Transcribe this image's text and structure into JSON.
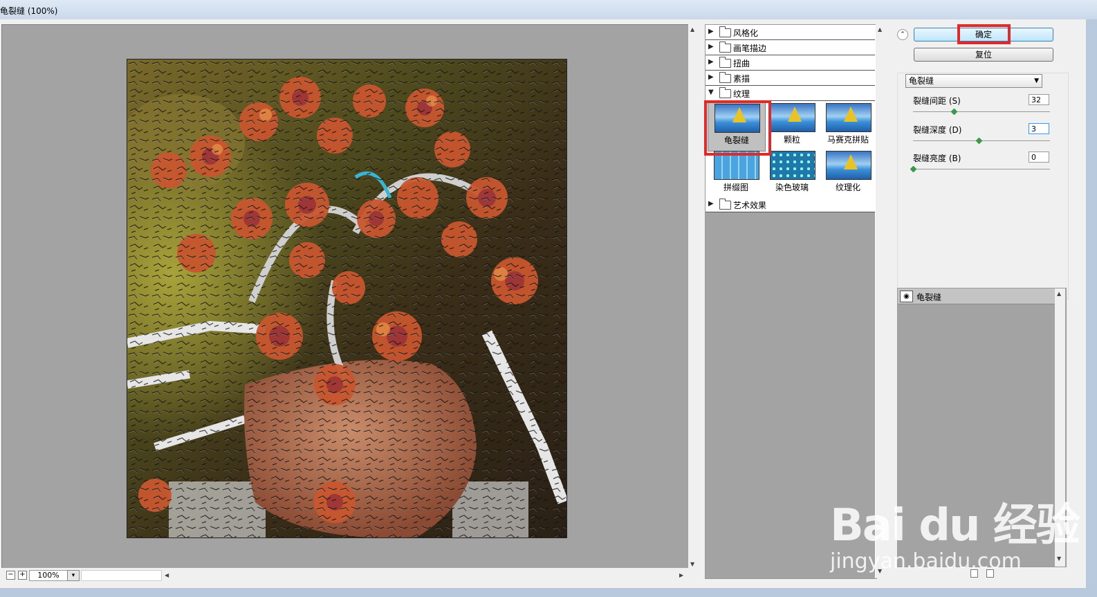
{
  "window": {
    "title": "龟裂缝 (100%)"
  },
  "preview": {
    "zoom_value": "100%",
    "zoom_out_symbol": "−",
    "zoom_in_symbol": "+",
    "dropdown_symbol": "▾",
    "image_alt": "Flowers in a vase with craquelure filter applied"
  },
  "gallery": {
    "categories_top": [
      {
        "label": "风格化",
        "expanded": false
      },
      {
        "label": "画笔描边",
        "expanded": false
      },
      {
        "label": "扭曲",
        "expanded": false
      },
      {
        "label": "素描",
        "expanded": false
      },
      {
        "label": "纹理",
        "expanded": true
      }
    ],
    "texture_filters": [
      {
        "label": "龟裂缝",
        "selected": true
      },
      {
        "label": "颗粒",
        "selected": false
      },
      {
        "label": "马赛克拼贴",
        "selected": false
      },
      {
        "label": "拼缀图",
        "selected": false
      },
      {
        "label": "染色玻璃",
        "selected": false
      },
      {
        "label": "纹理化",
        "selected": false
      }
    ],
    "category_bottom": {
      "label": "艺术效果",
      "expanded": false
    }
  },
  "settings": {
    "collapse_symbol": "⌃",
    "ok_label": "确定",
    "reset_label": "复位",
    "filter_select": "龟裂缝",
    "params": [
      {
        "label": "裂缝间距 (S)",
        "value": "32",
        "fraction": 0.31
      },
      {
        "label": "裂缝深度 (D)",
        "value": "3",
        "fraction": 0.5
      },
      {
        "label": "裂缝亮度 (B)",
        "value": "0",
        "fraction": 0.0
      }
    ]
  },
  "layers": {
    "items": [
      {
        "label": "龟裂缝",
        "visible": true
      }
    ]
  },
  "watermark": {
    "logo": "Bai du 经验",
    "url": "jingyan.baidu.com"
  },
  "colors": {
    "highlight": "#e02a2a",
    "panel_gray": "#a3a3a3",
    "slider_thumb": "#3a9a4a"
  }
}
